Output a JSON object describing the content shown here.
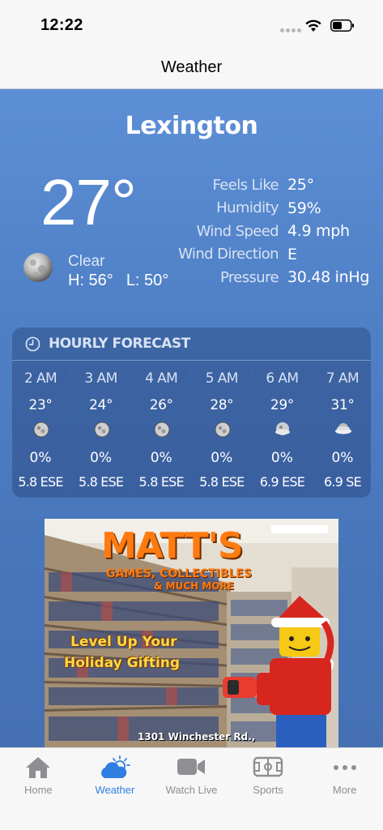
{
  "status_bar": {
    "time": "12:22"
  },
  "nav": {
    "title": "Weather"
  },
  "current": {
    "city": "Lexington",
    "temperature": "27°",
    "condition": "Clear",
    "condition_icon": "moon-icon",
    "high": "H: 56°",
    "low": "L: 50°"
  },
  "details": [
    {
      "label": "Feels Like",
      "value": "25°"
    },
    {
      "label": "Humidity",
      "value": "59%"
    },
    {
      "label": "Wind Speed",
      "value": "4.9 mph"
    },
    {
      "label": "Wind Direction",
      "value": "E"
    },
    {
      "label": "Pressure",
      "value": "30.48 inHg"
    }
  ],
  "hourly": {
    "title": "HOURLY FORECAST",
    "hours": [
      {
        "time": "2 AM",
        "temp": "23°",
        "icon": "moon-icon",
        "precip": "0%",
        "wind": "5.8 ESE"
      },
      {
        "time": "3 AM",
        "temp": "24°",
        "icon": "moon-icon",
        "precip": "0%",
        "wind": "5.8 ESE"
      },
      {
        "time": "4 AM",
        "temp": "26°",
        "icon": "moon-icon",
        "precip": "0%",
        "wind": "5.8 ESE"
      },
      {
        "time": "5 AM",
        "temp": "28°",
        "icon": "moon-icon",
        "precip": "0%",
        "wind": "5.8 ESE"
      },
      {
        "time": "6 AM",
        "temp": "29°",
        "icon": "moon-cloud-icon",
        "precip": "0%",
        "wind": "6.9 ESE"
      },
      {
        "time": "7 AM",
        "temp": "31°",
        "icon": "cloudy-moon-icon",
        "precip": "0%",
        "wind": "6.9 SE"
      }
    ]
  },
  "ad": {
    "brand": "MATT'S",
    "subtitle": "GAMES, COLLECTIBLES",
    "subtitle2": "& MUCH MORE",
    "promo_line1": "Level Up Your",
    "promo_line2": "Holiday Gifting",
    "address": "1301 Winchester Rd.,"
  },
  "tabs": [
    {
      "label": "Home",
      "icon": "home-icon",
      "active": false
    },
    {
      "label": "Weather",
      "icon": "weather-icon",
      "active": true
    },
    {
      "label": "Watch Live",
      "icon": "video-camera-icon",
      "active": false
    },
    {
      "label": "Sports",
      "icon": "sports-field-icon",
      "active": false
    },
    {
      "label": "More",
      "icon": "more-dots-icon",
      "active": false
    }
  ],
  "colors": {
    "accent": "#2f7ee0",
    "panel_bg": "#4f80c6",
    "tab_inactive": "#8e8e93"
  }
}
